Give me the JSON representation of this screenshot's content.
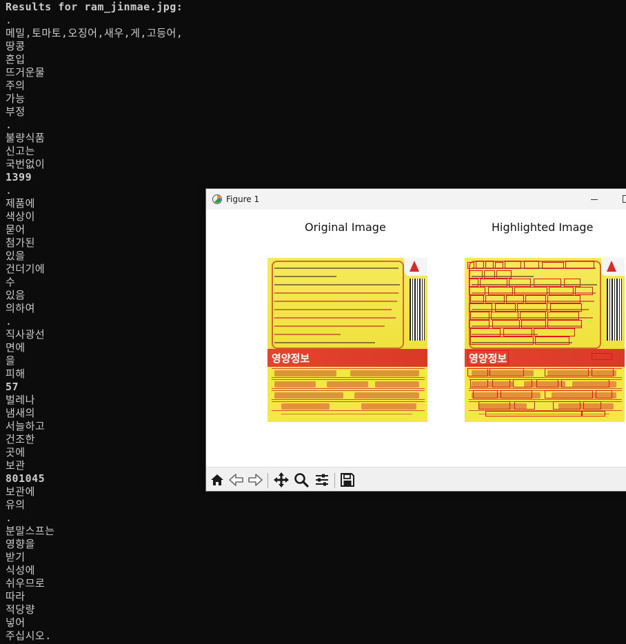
{
  "terminal": {
    "lines": [
      "Results for ram_jinmae.jpg:",
      ".",
      "메밀,토마토,오징어,새우,게,고등어,",
      "땅콩",
      "혼입",
      "뜨거운물",
      "주의",
      "가능",
      "부정",
      ".",
      "불량식품",
      "신고는",
      "국번없이",
      "1399",
      ".",
      "제품에",
      "색상이",
      "묻어",
      "첨가된",
      "있을",
      "건더기에",
      "수",
      "있음",
      "의하여",
      ".",
      "직사광선",
      "면에",
      "을",
      "피해",
      "57",
      "벌레나",
      "냄새의",
      "서늘하고",
      "건조한",
      "곳에",
      "보관",
      "801045",
      "보관에",
      "유의",
      ".",
      "분말스프는",
      "영향을",
      "받기",
      "식성에",
      "쉬우므로",
      "따라",
      "적당량",
      "넣어",
      "주십시오."
    ]
  },
  "window": {
    "title": "Figure 1",
    "icon": "matplotlib-icon"
  },
  "figure": {
    "left_title": "Original Image",
    "right_title": "Highlighted Image",
    "photo": {
      "nutrition_header": "영양정보",
      "highlight_color": "#e3141e",
      "label_background": "#f2e33c",
      "band_color": "#e4442d"
    }
  },
  "toolbar": {
    "buttons": [
      {
        "name": "home-icon"
      },
      {
        "name": "back-icon"
      },
      {
        "name": "forward-icon"
      },
      {
        "name": "pan-icon"
      },
      {
        "name": "zoom-icon"
      },
      {
        "name": "configure-subplots-icon"
      },
      {
        "name": "save-icon"
      }
    ]
  },
  "colors": {
    "terminal_bg": "#0c0c0c",
    "terminal_fg": "#cccccc",
    "window_bg": "#ffffff",
    "toolbar_bg": "#f0f0f0"
  }
}
